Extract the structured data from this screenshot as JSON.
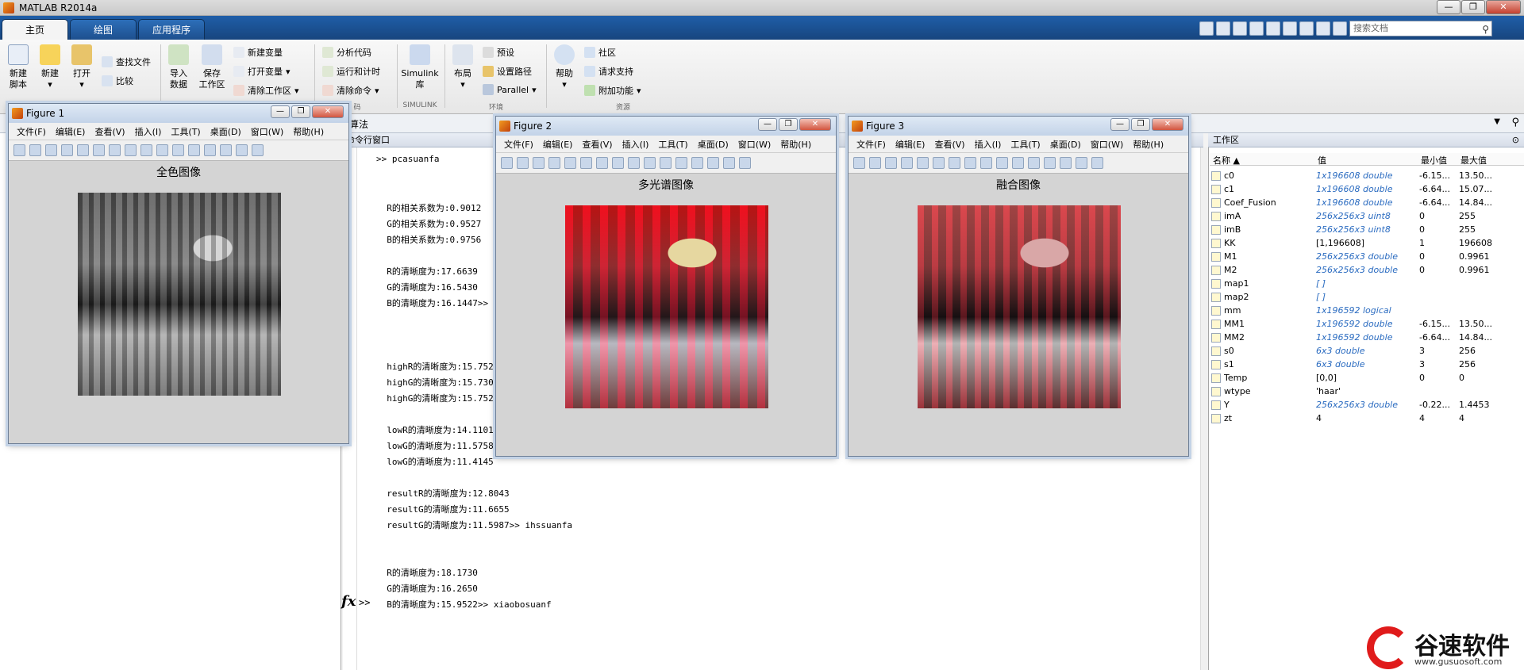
{
  "app": {
    "title": "MATLAB R2014a"
  },
  "tabs": [
    "主页",
    "绘图",
    "应用程序"
  ],
  "search": {
    "placeholder": "搜索文档"
  },
  "ribbon": {
    "new_script": "新建\n脚本",
    "new": "新建",
    "open": "打开",
    "find_files": "查找文件",
    "compare": "比较",
    "import": "导入\n数据",
    "save_ws": "保存\n工作区",
    "new_var": "新建变量",
    "open_var": "打开变量",
    "clear_ws": "清除工作区",
    "analyze": "分析代码",
    "run_time": "运行和计时",
    "clear_cmd": "清除命令",
    "simulink": "Simulink\n库",
    "layout": "布局",
    "prefs": "预设",
    "set_path": "设置路径",
    "parallel": "Parallel",
    "help": "帮助",
    "community": "社区",
    "support": "请求支持",
    "addons": "附加功能",
    "groups": [
      "码",
      "SIMULINK",
      "环境",
      "资源"
    ]
  },
  "addr": {
    "path": "算法"
  },
  "cmd": {
    "header": "命令行窗口",
    "lines": [
      ">> pcasuanfa",
      "",
      "",
      "  R的相关系数为:0.9012",
      "  G的相关系数为:0.9527",
      "  B的相关系数为:0.9756",
      "",
      "  R的清晰度为:17.6639",
      "  G的清晰度为:16.5430",
      "  B的清晰度为:16.1447>>",
      "",
      "",
      "",
      "  highR的清晰度为:15.752",
      "  highG的清晰度为:15.730",
      "  highG的清晰度为:15.752",
      "",
      "  lowR的清晰度为:14.1101",
      "  lowG的清晰度为:11.5758",
      "  lowG的清晰度为:11.4145",
      "",
      "  resultR的清晰度为:12.8043",
      "  resultG的清晰度为:11.6655",
      "  resultG的清晰度为:11.5987>> ihssuanfa",
      "",
      "",
      "  R的清晰度为:18.1730",
      "  G的清晰度为:16.2650",
      "  B的清晰度为:15.9522>> xiaobosuanf"
    ],
    "fx": "fx",
    "prompt": ">>"
  },
  "workspace": {
    "header": "工作区",
    "cols": [
      "名称 ▲",
      "值",
      "最小值",
      "最大值"
    ],
    "rows": [
      {
        "n": "c0",
        "v": "1x196608 double",
        "mi": "-6.15...",
        "ma": "13.50...",
        "it": true
      },
      {
        "n": "c1",
        "v": "1x196608 double",
        "mi": "-6.64...",
        "ma": "15.07...",
        "it": true
      },
      {
        "n": "Coef_Fusion",
        "v": "1x196608 double",
        "mi": "-6.64...",
        "ma": "14.84...",
        "it": true
      },
      {
        "n": "imA",
        "v": "256x256x3 uint8",
        "mi": "0",
        "ma": "255",
        "it": true
      },
      {
        "n": "imB",
        "v": "256x256x3 uint8",
        "mi": "0",
        "ma": "255",
        "it": true
      },
      {
        "n": "KK",
        "v": "[1,196608]",
        "mi": "1",
        "ma": "196608",
        "it": false
      },
      {
        "n": "M1",
        "v": "256x256x3 double",
        "mi": "0",
        "ma": "0.9961",
        "it": true
      },
      {
        "n": "M2",
        "v": "256x256x3 double",
        "mi": "0",
        "ma": "0.9961",
        "it": true
      },
      {
        "n": "map1",
        "v": "[ ]",
        "mi": "",
        "ma": "",
        "it": true
      },
      {
        "n": "map2",
        "v": "[ ]",
        "mi": "",
        "ma": "",
        "it": true
      },
      {
        "n": "mm",
        "v": "1x196592 logical",
        "mi": "",
        "ma": "",
        "it": true
      },
      {
        "n": "MM1",
        "v": "1x196592 double",
        "mi": "-6.15...",
        "ma": "13.50...",
        "it": true
      },
      {
        "n": "MM2",
        "v": "1x196592 double",
        "mi": "-6.64...",
        "ma": "14.84...",
        "it": true
      },
      {
        "n": "s0",
        "v": "6x3 double",
        "mi": "3",
        "ma": "256",
        "it": true
      },
      {
        "n": "s1",
        "v": "6x3 double",
        "mi": "3",
        "ma": "256",
        "it": true
      },
      {
        "n": "Temp",
        "v": "[0,0]",
        "mi": "0",
        "ma": "0",
        "it": false
      },
      {
        "n": "wtype",
        "v": "'haar'",
        "mi": "",
        "ma": "",
        "it": false
      },
      {
        "n": "Y",
        "v": "256x256x3 double",
        "mi": "-0.22...",
        "ma": "1.4453",
        "it": true
      },
      {
        "n": "zt",
        "v": "4",
        "mi": "4",
        "ma": "4",
        "it": false
      }
    ]
  },
  "figures": [
    {
      "title": "Figure 1",
      "caption": "全色图像"
    },
    {
      "title": "Figure 2",
      "caption": "多光谱图像"
    },
    {
      "title": "Figure 3",
      "caption": "融合图像"
    }
  ],
  "figmenu": [
    "文件(F)",
    "编辑(E)",
    "查看(V)",
    "插入(I)",
    "工具(T)",
    "桌面(D)",
    "窗口(W)",
    "帮助(H)"
  ],
  "watermark": {
    "brand": "谷速软件",
    "url": "www.gusuosoft.com"
  },
  "colors": {
    "accent": "#1f5ea8",
    "link": "#2a6bc0",
    "brand_red": "#e01b1b"
  }
}
